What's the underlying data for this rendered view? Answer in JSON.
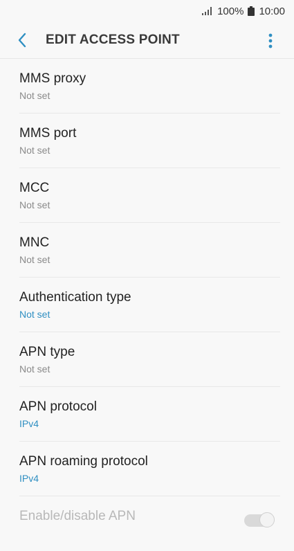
{
  "status_bar": {
    "battery": "100%",
    "time": "10:00",
    "signal_icon": "signal-icon",
    "battery_icon": "battery-icon"
  },
  "app_bar": {
    "title": "EDIT ACCESS POINT",
    "back_icon": "chevron-left-icon",
    "more_icon": "more-vert-icon"
  },
  "colors": {
    "accent": "#2f8fc2",
    "text": "#222222",
    "subtext": "#8a8a8a"
  },
  "settings": [
    {
      "title": "MMS proxy",
      "value": "Not set"
    },
    {
      "title": "MMS port",
      "value": "Not set"
    },
    {
      "title": "MCC",
      "value": "Not set"
    },
    {
      "title": "MNC",
      "value": "Not set"
    },
    {
      "title": "Authentication type",
      "value": "Not set"
    },
    {
      "title": "APN type",
      "value": "Not set"
    },
    {
      "title": "APN protocol",
      "value": "IPv4"
    },
    {
      "title": "APN roaming protocol",
      "value": "IPv4"
    },
    {
      "title": "Enable/disable APN",
      "value": ""
    }
  ]
}
